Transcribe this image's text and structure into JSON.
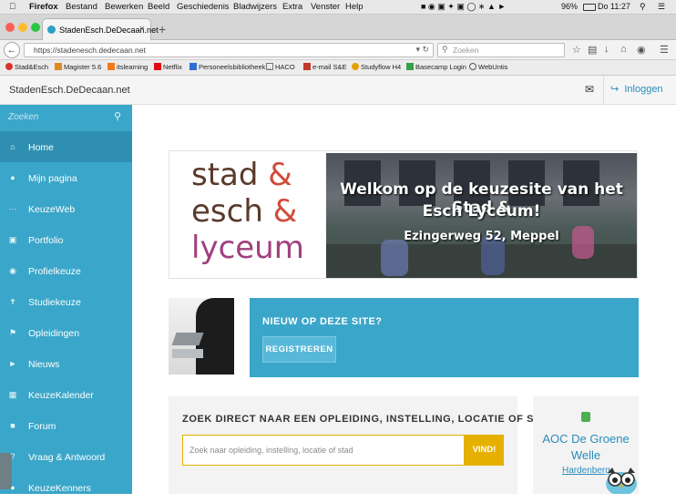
{
  "menubar": {
    "app": "Firefox",
    "items": [
      "Bestand",
      "Bewerken",
      "Beeld",
      "Geschiedenis",
      "Bladwijzers",
      "Extra",
      "Venster",
      "Help"
    ],
    "battery": "96%",
    "clock": "Do 11:27"
  },
  "browser": {
    "tab_title": "StadenEsch.DeDecaan.net",
    "url": "https://stadenesch.dedecaan.net",
    "search_placeholder": "Zoeken",
    "bookmarks": [
      "Stad&Esch",
      "Magister 5.6",
      "itslearning",
      "Netflix",
      "Personeelsbibliotheek...",
      "HACO",
      "e-mail S&E",
      "Studyflow H4",
      "Basecamp Login",
      "WebUntis"
    ]
  },
  "header": {
    "site_title": "StadenEsch.DeDecaan.net",
    "login_label": "Inloggen"
  },
  "sidebar": {
    "search_placeholder": "Zoeken",
    "items": [
      {
        "label": "Home",
        "icon": "home-icon"
      },
      {
        "label": "Mijn pagina",
        "icon": "user-icon"
      },
      {
        "label": "KeuzeWeb",
        "icon": "dots-icon"
      },
      {
        "label": "Portfolio",
        "icon": "briefcase-icon"
      },
      {
        "label": "Profielkeuze",
        "icon": "globe-icon"
      },
      {
        "label": "Studiekeuze",
        "icon": "signpost-icon"
      },
      {
        "label": "Opleidingen",
        "icon": "flag-icon"
      },
      {
        "label": "Nieuws",
        "icon": "megaphone-icon"
      },
      {
        "label": "KeuzeKalender",
        "icon": "calendar-icon"
      },
      {
        "label": "Forum",
        "icon": "chat-icon"
      },
      {
        "label": "Vraag & Antwoord",
        "icon": "question-icon"
      },
      {
        "label": "KeuzeKenners",
        "icon": "users-icon"
      }
    ]
  },
  "banner": {
    "logo_line1": "stad",
    "logo_line2": "esch",
    "logo_line3": "lyceum",
    "amp": "&",
    "welcome_line1": "Welkom op de keuzesite van het Stad &",
    "welcome_line2": "Esch Lyceum!",
    "address": "Ezingerweg 52, Meppel"
  },
  "news": {
    "title": "NIEUW OP DEZE SITE?",
    "button": "REGISTREREN"
  },
  "search_panel": {
    "title": "ZOEK DIRECT NAAR EEN OPLEIDING, INSTELLING, LOCATIE OF STAD",
    "placeholder": "Zoek naar opleiding, instelling, locatie of stad",
    "button": "VIND!"
  },
  "school_card": {
    "name": "AOC De Groene Welle",
    "city": "Hardenberg"
  },
  "colors": {
    "sidebar": "#3aa6c9",
    "accent_yellow": "#e6b000",
    "logo_brown": "#5a3a2a",
    "logo_red": "#d24a3c",
    "logo_purple": "#a0407e"
  }
}
